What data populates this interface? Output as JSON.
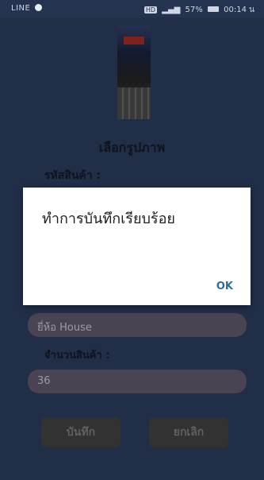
{
  "statusbar": {
    "carrier": "LINE",
    "battery_percent": "57%",
    "time": "00:14 น"
  },
  "form": {
    "choose_image_label": "เลือกรูปภาพ",
    "code_label": "รหัสสินค้า :",
    "brand_value": "ยี่ห้อ House",
    "quantity_label": "จำนวนสินค้า :",
    "quantity_value": "36",
    "save_label": "บันทึก",
    "cancel_label": "ยกเลิก"
  },
  "dialog": {
    "message": "ทำการบันทึกเรียบร้อย",
    "ok_label": "OK"
  },
  "icons": {
    "app_notification": "line-app-icon",
    "signal": "signal-icon",
    "battery": "battery-icon"
  }
}
